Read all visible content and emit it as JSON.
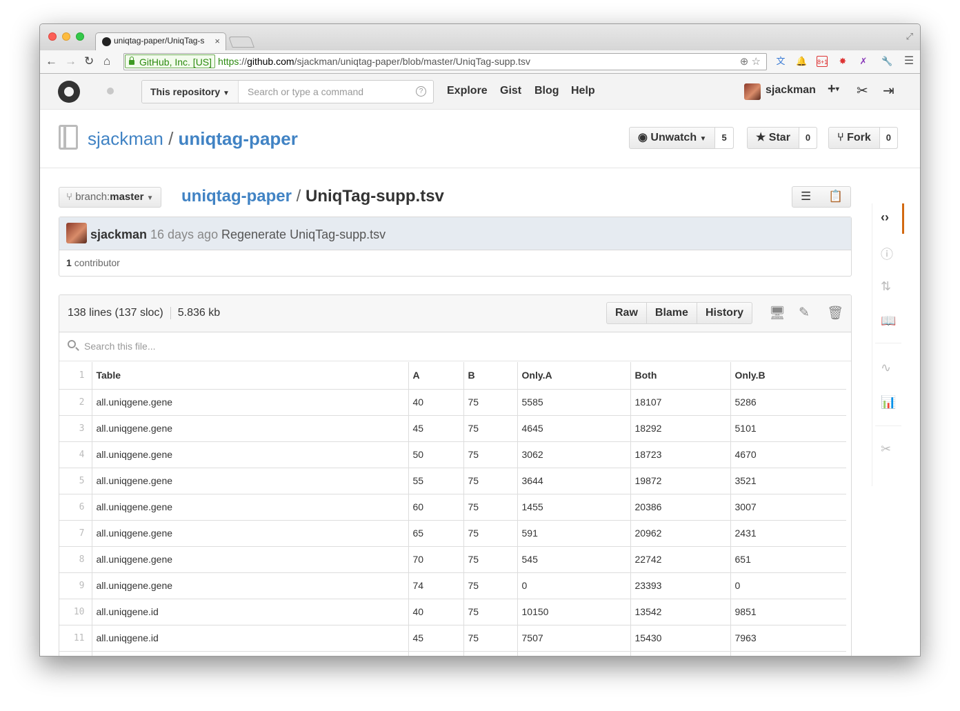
{
  "browser": {
    "tab_title": "uniqtag-paper/UniqTag-s",
    "tab_close": "×",
    "ev_label": "GitHub, Inc. [US]",
    "url_scheme": "https",
    "url_sep": "://",
    "url_host": "github.com",
    "url_path": "/sjackman/uniqtag-paper/blob/master/UniqTag-supp.tsv"
  },
  "header": {
    "scope_label": "This repository",
    "search_placeholder": "Search or type a command",
    "help": "?",
    "nav": [
      "Explore",
      "Gist",
      "Blog",
      "Help"
    ],
    "username": "sjackman",
    "plus": "+"
  },
  "repo": {
    "owner": "sjackman",
    "separator": "/",
    "name": "uniqtag-paper",
    "watch_label": "Unwatch",
    "watch_count": "5",
    "star_label": "Star",
    "star_count": "0",
    "fork_label": "Fork",
    "fork_count": "0"
  },
  "file_nav": {
    "branch_prefix": "branch:",
    "branch_name": "master",
    "crumb_repo": "uniqtag-paper",
    "crumb_sep": "/",
    "crumb_file": "UniqTag-supp.tsv"
  },
  "commit": {
    "author": "sjackman",
    "age": "16 days ago",
    "message": "Regenerate UniqTag-supp.tsv",
    "contributors_count": "1",
    "contributors_label": "contributor"
  },
  "file": {
    "lines": "138 lines (137 sloc)",
    "size": "5.836 kb",
    "actions": [
      "Raw",
      "Blame",
      "History"
    ],
    "search_placeholder": "Search this file..."
  },
  "table": {
    "header_line": "1",
    "columns": [
      "Table",
      "A",
      "B",
      "Only.A",
      "Both",
      "Only.B"
    ],
    "rows": [
      {
        "line": "2",
        "cells": [
          "all.uniqgene.gene",
          "40",
          "75",
          "5585",
          "18107",
          "5286"
        ]
      },
      {
        "line": "3",
        "cells": [
          "all.uniqgene.gene",
          "45",
          "75",
          "4645",
          "18292",
          "5101"
        ]
      },
      {
        "line": "4",
        "cells": [
          "all.uniqgene.gene",
          "50",
          "75",
          "3062",
          "18723",
          "4670"
        ]
      },
      {
        "line": "5",
        "cells": [
          "all.uniqgene.gene",
          "55",
          "75",
          "3644",
          "19872",
          "3521"
        ]
      },
      {
        "line": "6",
        "cells": [
          "all.uniqgene.gene",
          "60",
          "75",
          "1455",
          "20386",
          "3007"
        ]
      },
      {
        "line": "7",
        "cells": [
          "all.uniqgene.gene",
          "65",
          "75",
          "591",
          "20962",
          "2431"
        ]
      },
      {
        "line": "8",
        "cells": [
          "all.uniqgene.gene",
          "70",
          "75",
          "545",
          "22742",
          "651"
        ]
      },
      {
        "line": "9",
        "cells": [
          "all.uniqgene.gene",
          "74",
          "75",
          "0",
          "23393",
          "0"
        ]
      },
      {
        "line": "10",
        "cells": [
          "all.uniqgene.id",
          "40",
          "75",
          "10150",
          "13542",
          "9851"
        ]
      },
      {
        "line": "11",
        "cells": [
          "all.uniqgene.id",
          "45",
          "75",
          "7507",
          "15430",
          "7963"
        ]
      },
      {
        "line": "",
        "cells": [
          "",
          "",
          "",
          "",
          "",
          ""
        ]
      }
    ]
  },
  "colors": {
    "link": "#4183c4",
    "accent_bar": "#d26911",
    "commit_bg": "#e6ebf1"
  }
}
